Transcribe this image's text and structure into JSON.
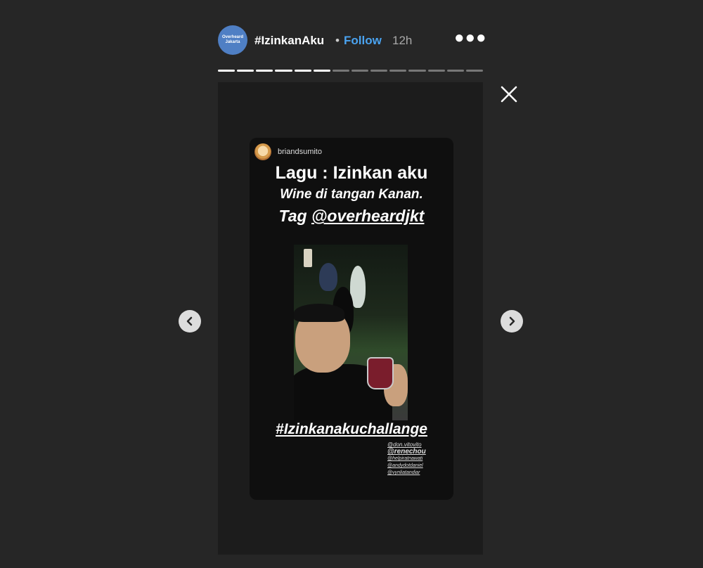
{
  "header": {
    "avatar_line1": "Overheard",
    "avatar_line2": "Jakarta",
    "username": "#IzinkanAku",
    "separator": "•",
    "follow_label": "Follow",
    "time": "12h",
    "more_icon": "more-dots-icon"
  },
  "progress": {
    "total_segments": 14,
    "completed_segments": 6
  },
  "post": {
    "author": "briandsumito",
    "line1": "Lagu : Izinkan aku",
    "line2": "Wine di tangan Kanan.",
    "line3_prefix": "Tag ",
    "line3_mention": "@overheardjkt",
    "hashtag": "#Izinkanakuchallange",
    "tags": [
      "@don.vitovito",
      "@renechou",
      "@helpiratnawati",
      "@andydotdaniel",
      "@vynliatandiar"
    ]
  },
  "nav": {
    "prev_icon": "chevron-left-icon",
    "next_icon": "chevron-right-icon",
    "close_icon": "close-icon"
  },
  "colors": {
    "background": "#262626",
    "follow": "#4aa3f0",
    "avatar": "#4f7fc4"
  }
}
